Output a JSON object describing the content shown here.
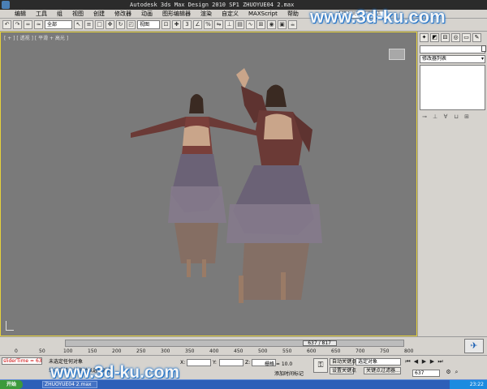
{
  "window": {
    "title": "Autodesk 3ds Max Design 2010 SP1    ZHUOYUE04 2.max",
    "search_placeholder": "输入关键字或短语"
  },
  "menu": [
    "编辑",
    "工具",
    "组",
    "视图",
    "创建",
    "修改器",
    "动画",
    "图形编辑器",
    "渲染",
    "自定义",
    "MAXScript",
    "帮助"
  ],
  "watermark": "www.3d-ku.com",
  "toolbar": {
    "selection_filter": "全部",
    "reference_coord": "视图"
  },
  "viewport": {
    "label": "[ + ] [ 透视 ] [ 平滑 + 高光 ]"
  },
  "command_panel": {
    "modifier_list": "修改器列表"
  },
  "timeline": {
    "frame_counter": "637 / 817",
    "ticks": [
      "0",
      "50",
      "100",
      "150",
      "200",
      "250",
      "300",
      "350",
      "400",
      "450",
      "500",
      "550",
      "600",
      "650",
      "700",
      "750",
      "800"
    ]
  },
  "status": {
    "maxscript": "sliderTime = 637f",
    "prompt_top": "未选定任何对象",
    "prompt_bottom": "单击或单击并拖动以选择对象",
    "x_label": "X:",
    "y_label": "Y:",
    "z_label": "Z:",
    "grid": "栅格 = 10.0",
    "auto_key": "自动关键点",
    "set_key": "设置关键点",
    "selected_dropdown": "选定对象",
    "key_filters": "关键点过滤器...",
    "add_time_tag": "添加时间标记",
    "current_frame": "637"
  },
  "taskbar": {
    "start": "开始",
    "task": "ZHUOYUE04 2.max",
    "clock": "23:22"
  }
}
